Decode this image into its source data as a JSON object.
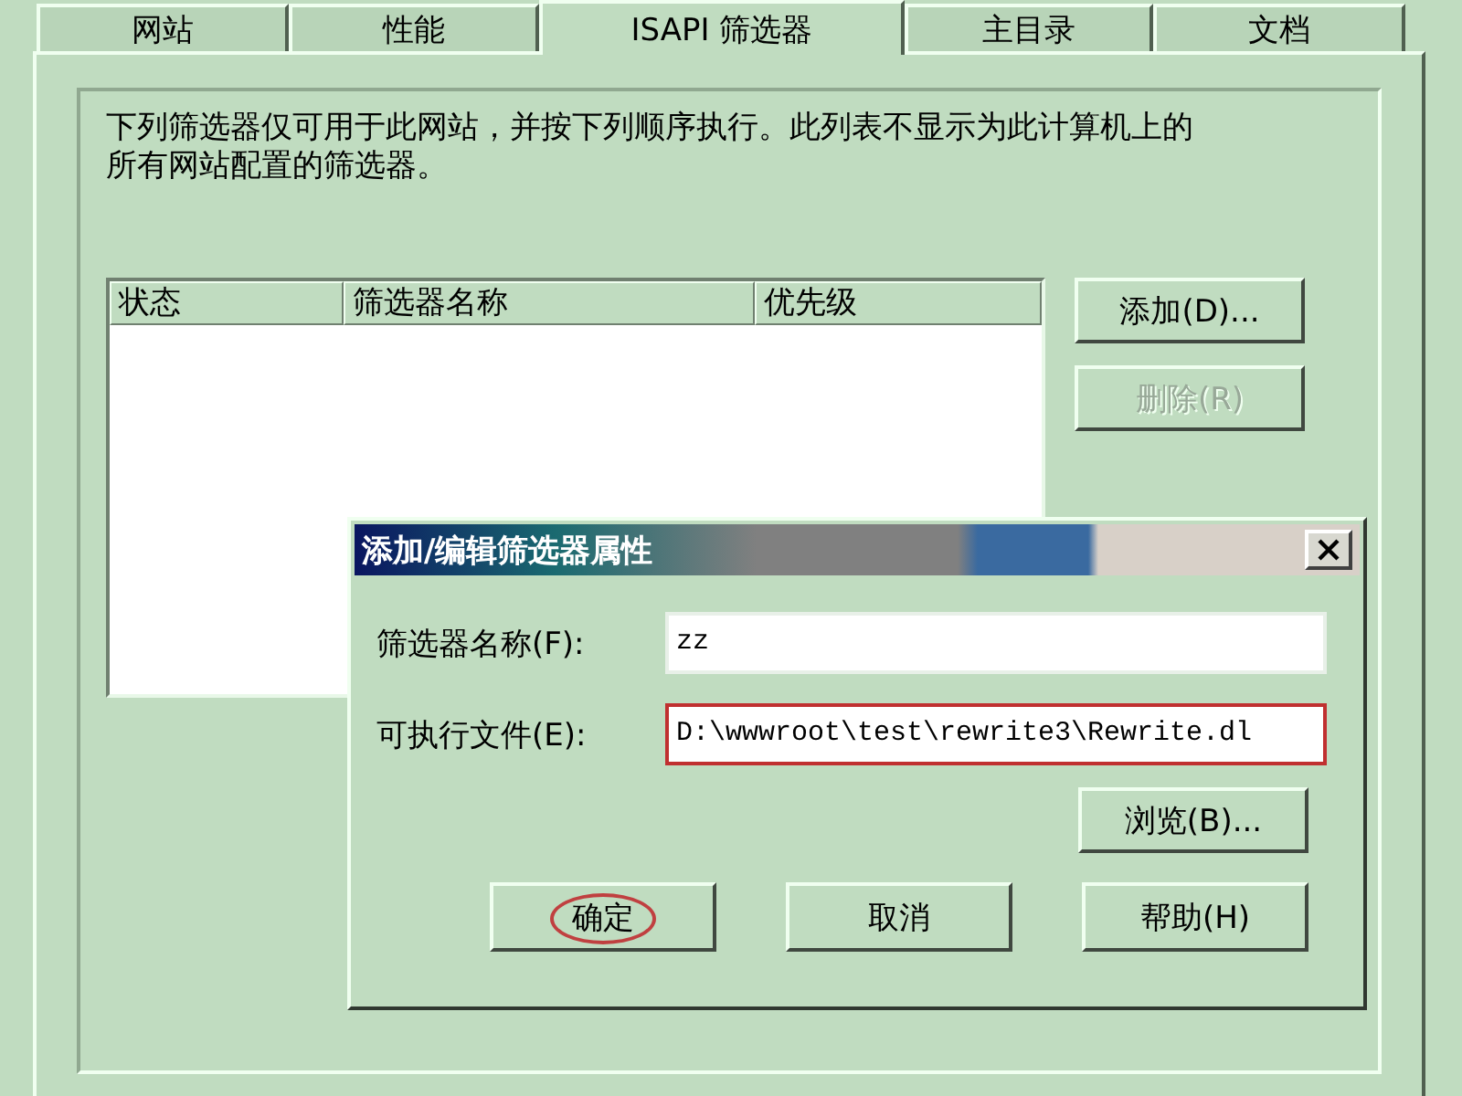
{
  "tabs": [
    {
      "label": "网站",
      "selected": false
    },
    {
      "label": "性能",
      "selected": false
    },
    {
      "label": "ISAPI 筛选器",
      "selected": true
    },
    {
      "label": "主目录",
      "selected": false
    },
    {
      "label": "文档",
      "selected": false
    }
  ],
  "description": "下列筛选器仅可用于此网站，并按下列顺序执行。此列表不显示为此计算机上的所有网站配置的筛选器。",
  "filter_table": {
    "columns": [
      "状态",
      "筛选器名称",
      "优先级"
    ]
  },
  "side_buttons": [
    {
      "label": "添加(D)...",
      "disabled": false
    },
    {
      "label": "删除(R)",
      "disabled": true
    }
  ],
  "dialog": {
    "title": "添加/编辑筛选器属性",
    "fields": [
      {
        "label": "筛选器名称(F):",
        "value": "zz",
        "annotated": false
      },
      {
        "label": "可执行文件(E):",
        "value": "D:\\wwwroot\\test\\rewrite3\\Rewrite.dl",
        "annotated": true
      }
    ],
    "browse_button": "浏览(B)...",
    "buttons": [
      {
        "label": "确定",
        "annotated": true
      },
      {
        "label": "取消",
        "annotated": false
      },
      {
        "label": "帮助(H)",
        "annotated": false
      }
    ]
  }
}
